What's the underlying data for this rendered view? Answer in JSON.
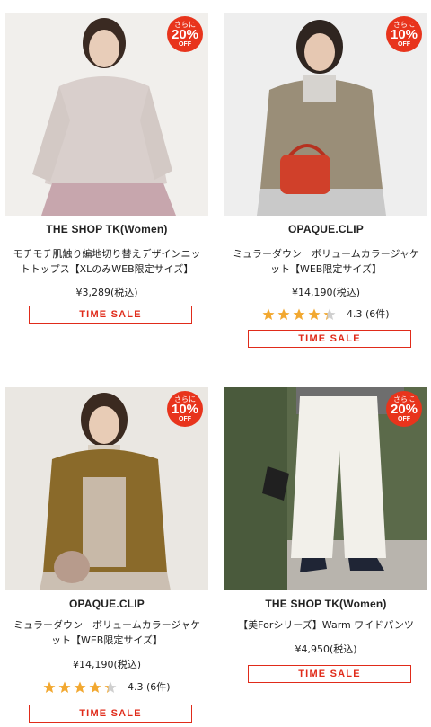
{
  "products": [
    {
      "brand": "THE SHOP TK(Women)",
      "name": "モチモチ肌触り編地切り替えデザインニットトップス【XLのみWEB限定サイズ】",
      "price": "¥3,289(税込)",
      "badge": {
        "line1": "さらに",
        "percent": "20%",
        "line3": "OFF"
      },
      "sale_label": "TIME SALE",
      "image_colors": {
        "bg": "#ece9e6",
        "top": "#d9cfcc",
        "bottom": "#c7a6ad"
      }
    },
    {
      "brand": "OPAQUE.CLIP",
      "name": "ミュラーダウン　ボリュームカラージャケット【WEB限定サイズ】",
      "price": "¥14,190(税込)",
      "rating": {
        "value": 4.3,
        "text": "4.3 (6件)"
      },
      "badge": {
        "line1": "さらに",
        "percent": "10%",
        "line3": "OFF"
      },
      "sale_label": "TIME SALE",
      "image_colors": {
        "bg": "#eeeeee",
        "top": "#9a8e78",
        "bottom": "#c9c9c9",
        "accent": "#d0402a"
      }
    },
    {
      "brand": "OPAQUE.CLIP",
      "name": "ミュラーダウン　ボリュームカラージャケット【WEB限定サイズ】",
      "price": "¥14,190(税込)",
      "rating": {
        "value": 4.3,
        "text": "4.3 (6件)"
      },
      "badge": {
        "line1": "さらに",
        "percent": "10%",
        "line3": "OFF"
      },
      "sale_label": "TIME SALE",
      "image_colors": {
        "bg": "#eae7e2",
        "top": "#8a6a2a",
        "bottom": "#c8b9a8",
        "accent": "#b79b8c"
      }
    },
    {
      "brand": "THE SHOP TK(Women)",
      "name": "【美Forシリーズ】Warm ワイドパンツ",
      "price": "¥4,950(税込)",
      "badge": {
        "line1": "さらに",
        "percent": "20%",
        "line3": "OFF"
      },
      "sale_label": "TIME SALE",
      "image_colors": {
        "bg": "#5b6a4a",
        "top": "#f2f0ea",
        "bottom": "#1f2535"
      }
    }
  ],
  "colors": {
    "accent": "#e02b1a",
    "badge": "#e8341c",
    "star": "#f2a830",
    "star_empty": "#cfcfcf"
  }
}
